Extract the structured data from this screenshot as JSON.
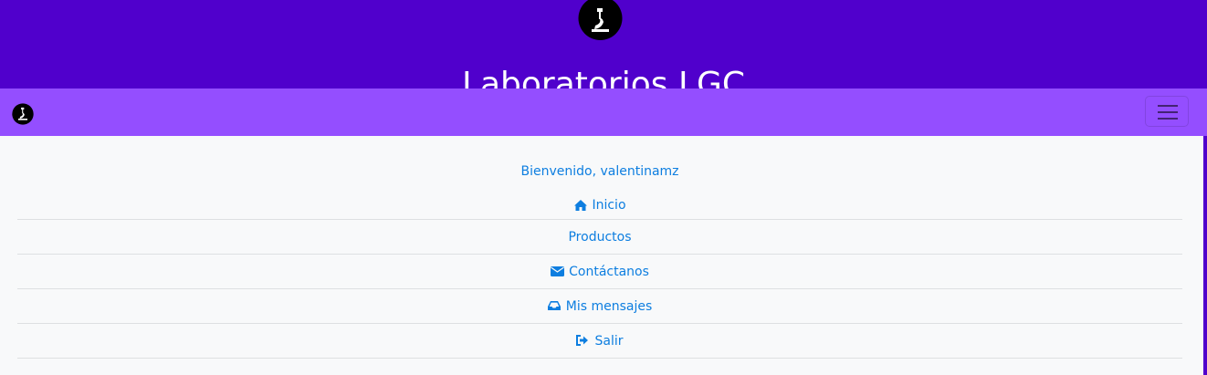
{
  "header": {
    "title": "Laboratorios LGC",
    "logo_icon": "microscope-icon"
  },
  "navbar": {
    "logo_icon": "microscope-icon",
    "toggle_icon": "hamburger-menu-icon"
  },
  "menu": {
    "welcome_text": "Bienvenido, valentinamz",
    "items": [
      {
        "label": "Inicio",
        "icon": "home-icon"
      },
      {
        "label": "Productos",
        "icon": ""
      },
      {
        "label": "Contáctanos",
        "icon": "envelope-icon"
      },
      {
        "label": "Mis mensajes",
        "icon": "inbox-icon"
      },
      {
        "label": "Salir",
        "icon": "sign-out-icon"
      }
    ]
  },
  "colors": {
    "header_bg": "#5000cc",
    "navbar_bg": "#944eff",
    "content_bg": "#f8f9fa",
    "link": "#0d7ee0"
  }
}
